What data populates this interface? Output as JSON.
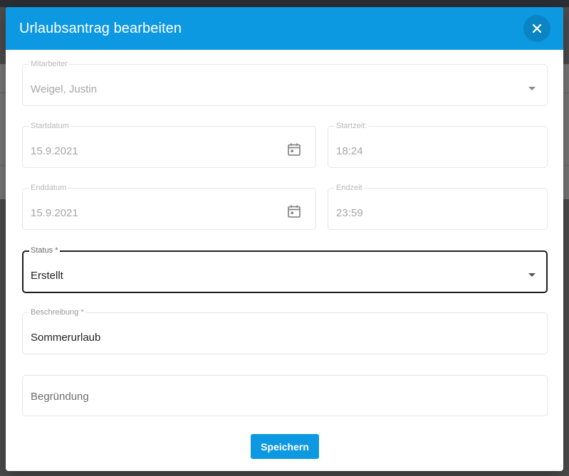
{
  "dialog": {
    "title": "Urlaubsantrag bearbeiten",
    "close_icon": "close-icon"
  },
  "form": {
    "employee": {
      "label": "Mitarbeiter",
      "value": "Weigel, Justin"
    },
    "start_date": {
      "label": "Startdatum",
      "value": "15.9.2021",
      "icon": "calendar-icon"
    },
    "start_time": {
      "label": "Startzeit:",
      "value": "18:24"
    },
    "end_date": {
      "label": "Enddatum",
      "value": "15.9.2021",
      "icon": "calendar-icon"
    },
    "end_time": {
      "label": "Endzeit",
      "value": "23:59"
    },
    "status": {
      "label": "Status *",
      "value": "Erstellt"
    },
    "description": {
      "label": "Beschreibung *",
      "value": "Sommerurlaub"
    },
    "reason": {
      "placeholder": "Begründung"
    },
    "save_label": "Speichern"
  },
  "colors": {
    "accent": "#0d98e2",
    "focused_border": "#1f1f1f"
  }
}
